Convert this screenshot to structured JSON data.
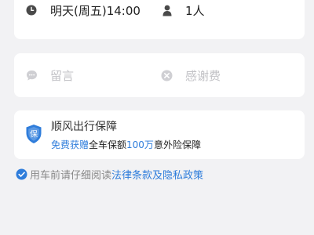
{
  "trip": {
    "time": "明天(周五)14:00",
    "time_icon": "clock-icon",
    "passengers": "1人",
    "passengers_icon": "person-icon"
  },
  "extras": {
    "message_placeholder": "留言",
    "message_icon": "chat-bubble-icon",
    "thanks_placeholder": "感谢费",
    "thanks_icon": "thanks-fee-icon"
  },
  "insurance": {
    "title": "顺风出行保障",
    "highlight": "免费获赠",
    "text_mid": "全车保额",
    "amount": "100万",
    "text_end": "意外险保障",
    "shield_char": "保",
    "shield_icon": "shield-icon"
  },
  "agreement": {
    "prefix": "用车前请仔细阅读",
    "link": "法律条款及隐私政策",
    "checked": true
  },
  "colors": {
    "accent": "#2f7ddb",
    "background": "#f2f2f4",
    "card": "#ffffff",
    "placeholder": "#c2c2c6"
  }
}
